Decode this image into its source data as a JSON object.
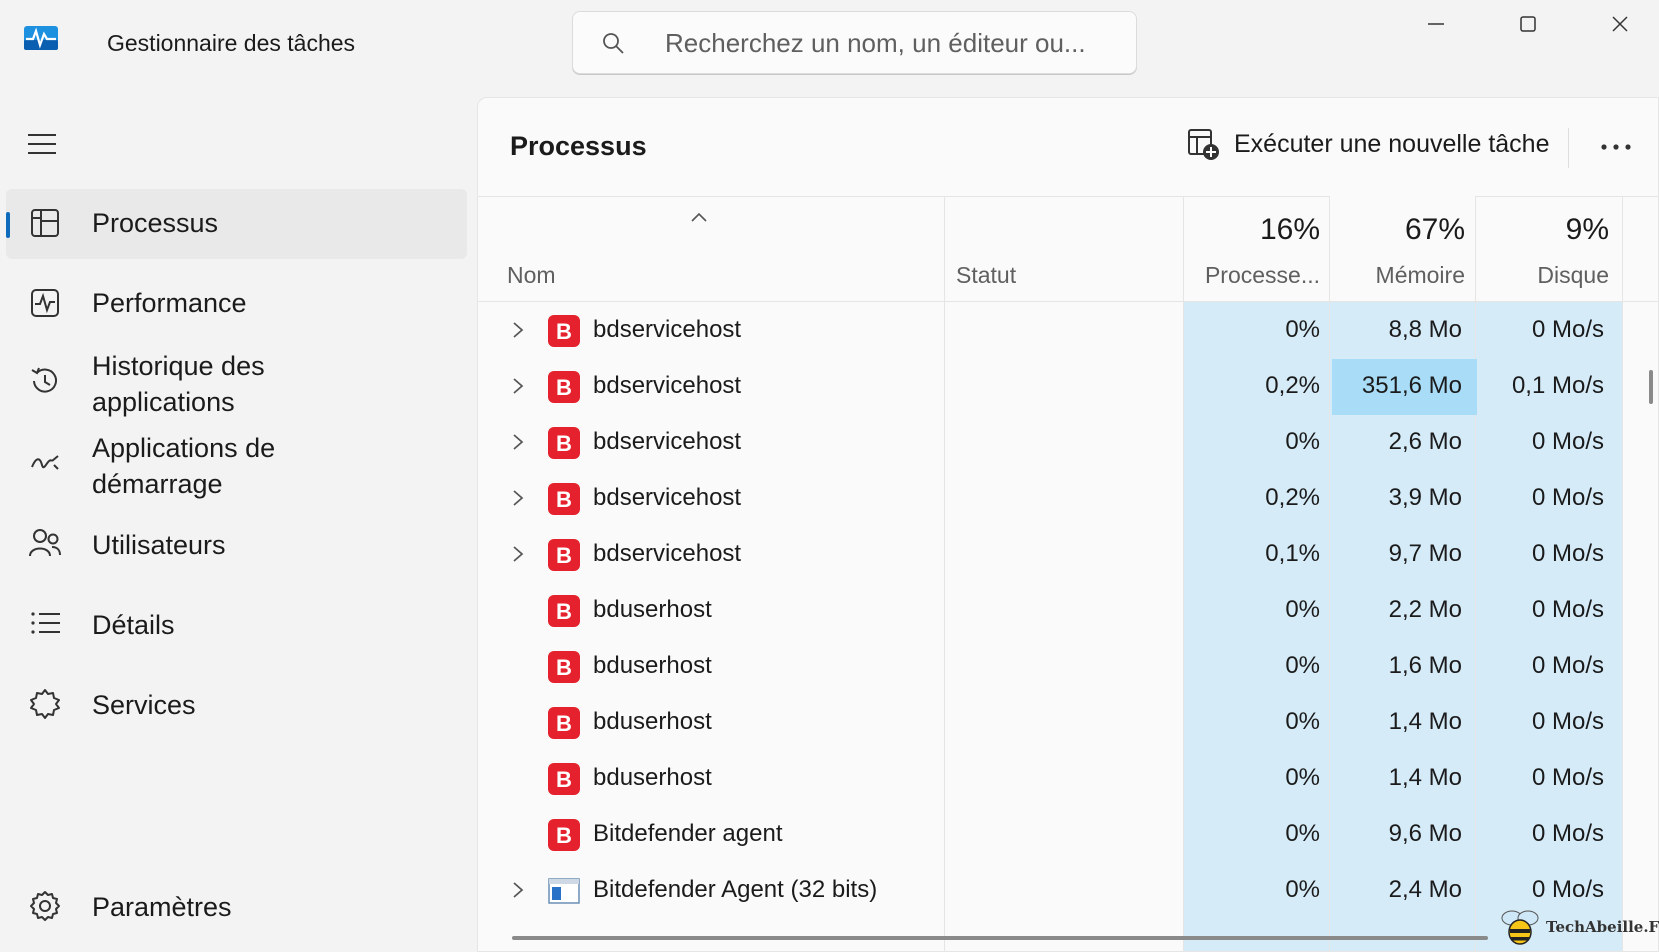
{
  "app": {
    "title": "Gestionnaire des tâches",
    "search_placeholder": "Recherchez un nom, un éditeur ou..."
  },
  "sidebar": {
    "items": [
      {
        "label": "Processus",
        "icon": "processes-icon",
        "active": true
      },
      {
        "label": "Performance",
        "icon": "performance-icon"
      },
      {
        "label": "Historique des",
        "label2": "applications",
        "icon": "history-icon"
      },
      {
        "label": "Applications de",
        "label2": "démarrage",
        "icon": "startup-icon"
      },
      {
        "label": "Utilisateurs",
        "icon": "users-icon"
      },
      {
        "label": "Détails",
        "icon": "details-icon"
      },
      {
        "label": "Services",
        "icon": "services-icon"
      }
    ],
    "settings_label": "Paramètres"
  },
  "main": {
    "title": "Processus",
    "run_task_label": "Exécuter une nouvelle tâche",
    "columns": {
      "name": "Nom",
      "status": "Statut",
      "cpu_pct": "16%",
      "cpu_label": "Processe...",
      "mem_pct": "67%",
      "mem_label": "Mémoire",
      "disk_pct": "9%",
      "disk_label": "Disque"
    },
    "rows": [
      {
        "name": "bdservicehost",
        "expandable": true,
        "cpu": "0%",
        "mem": "8,8 Mo",
        "disk": "0 Mo/s"
      },
      {
        "name": "bdservicehost",
        "expandable": true,
        "cpu": "0,2%",
        "mem": "351,6 Mo",
        "disk": "0,1 Mo/s",
        "mem_highlight": true
      },
      {
        "name": "bdservicehost",
        "expandable": true,
        "cpu": "0%",
        "mem": "2,6 Mo",
        "disk": "0 Mo/s"
      },
      {
        "name": "bdservicehost",
        "expandable": true,
        "cpu": "0,2%",
        "mem": "3,9 Mo",
        "disk": "0 Mo/s"
      },
      {
        "name": "bdservicehost",
        "expandable": true,
        "cpu": "0,1%",
        "mem": "9,7 Mo",
        "disk": "0 Mo/s"
      },
      {
        "name": "bduserhost",
        "expandable": false,
        "cpu": "0%",
        "mem": "2,2 Mo",
        "disk": "0 Mo/s"
      },
      {
        "name": "bduserhost",
        "expandable": false,
        "cpu": "0%",
        "mem": "1,6 Mo",
        "disk": "0 Mo/s"
      },
      {
        "name": "bduserhost",
        "expandable": false,
        "cpu": "0%",
        "mem": "1,4 Mo",
        "disk": "0 Mo/s"
      },
      {
        "name": "bduserhost",
        "expandable": false,
        "cpu": "0%",
        "mem": "1,4 Mo",
        "disk": "0 Mo/s"
      },
      {
        "name": "Bitdefender agent",
        "expandable": false,
        "cpu": "0%",
        "mem": "9,6 Mo",
        "disk": "0 Mo/s"
      },
      {
        "name": "Bitdefender Agent (32 bits)",
        "expandable": true,
        "cpu": "0%",
        "mem": "2,4 Mo",
        "disk": "0 Mo/s",
        "icon": "window-app-icon"
      }
    ]
  },
  "watermark": {
    "text": "TechAbeille.FR"
  },
  "colors": {
    "accent": "#0f6cbd",
    "column_highlight": "#d5ebf8",
    "cell_highlight": "#a9dcf7",
    "bitdefender_red": "#e5212d"
  }
}
